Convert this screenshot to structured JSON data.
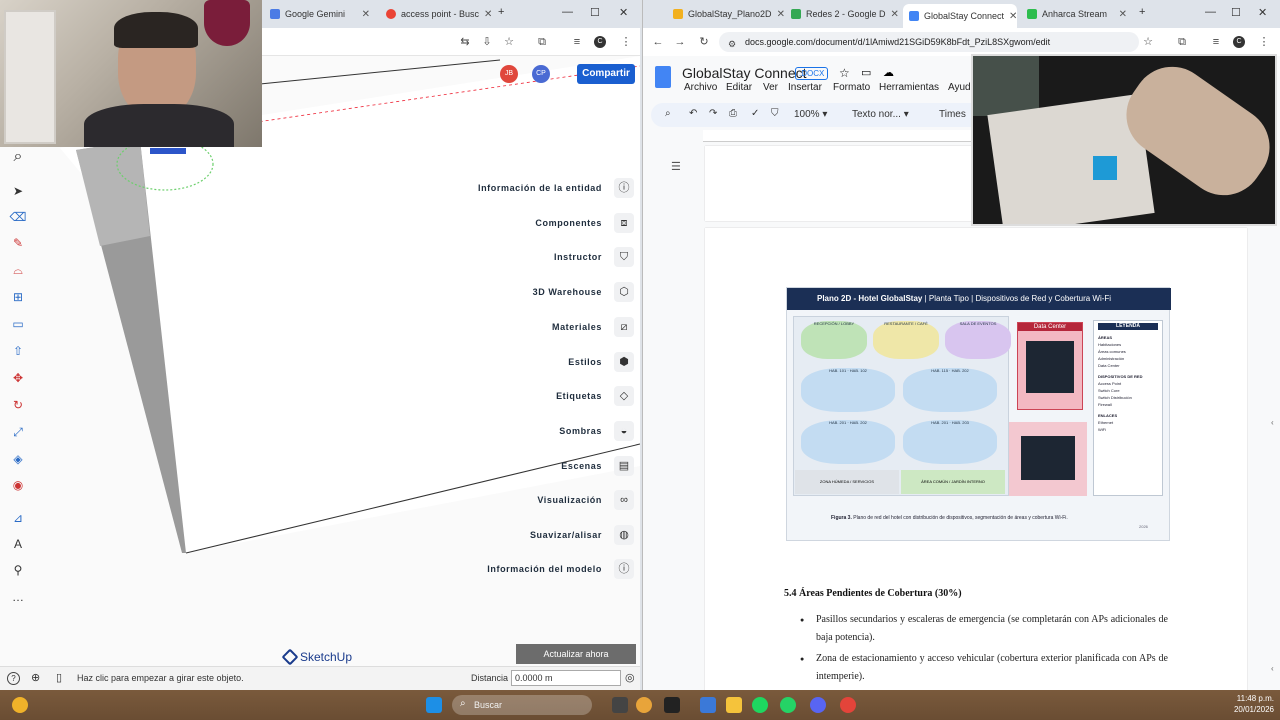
{
  "left_browser": {
    "tabs": [
      {
        "label": "Google Gemini",
        "active": false
      },
      {
        "label": "access point - Busc",
        "active": false
      }
    ],
    "share_button": "Compartir",
    "avatars": [
      "JB",
      "CP"
    ]
  },
  "sketchup": {
    "panel_items": [
      {
        "label": "Información de la entidad",
        "icon": "info-box-icon"
      },
      {
        "label": "Componentes",
        "icon": "components-icon"
      },
      {
        "label": "Instructor",
        "icon": "instructor-icon"
      },
      {
        "label": "3D Warehouse",
        "icon": "warehouse-icon"
      },
      {
        "label": "Materiales",
        "icon": "materials-icon"
      },
      {
        "label": "Estilos",
        "icon": "styles-icon"
      },
      {
        "label": "Etiquetas",
        "icon": "tags-icon"
      },
      {
        "label": "Sombras",
        "icon": "shadows-icon"
      },
      {
        "label": "Escenas",
        "icon": "scenes-icon"
      },
      {
        "label": "Visualización",
        "icon": "visualization-icon"
      },
      {
        "label": "Suavizar/alisar",
        "icon": "smooth-icon"
      },
      {
        "label": "Información del modelo",
        "icon": "model-info-icon"
      }
    ],
    "update_button": "Actualizar ahora",
    "logo_text": "SketchUp",
    "status_hint": "Haz clic para empezar a girar este objeto.",
    "distance_label": "Distancia",
    "distance_value": "0.0000 m"
  },
  "right_browser": {
    "tabs": [
      {
        "label": "GlobalStay_Plano2D",
        "active": false
      },
      {
        "label": "Redes 2 - Google D",
        "active": false
      },
      {
        "label": "GlobalStay Connect",
        "active": true
      },
      {
        "label": "Anharca Stream",
        "active": false
      }
    ],
    "url": "docs.google.com/document/d/1lAmiwd21SGiD59K8bFdt_PziL8SXgwom/edit"
  },
  "docs": {
    "title": "GlobalStay Connect",
    "badge": ".DOCX",
    "menu": [
      "Archivo",
      "Editar",
      "Ver",
      "Insertar",
      "Formato",
      "Herramientas",
      "Ayud"
    ],
    "zoom": "100%",
    "style": "Texto nor...",
    "font": "Times",
    "figure": {
      "title": "Plano 2D - Hotel GlobalStay",
      "subtitle1": "Planta Tipo",
      "subtitle2": "Dispositivos de Red y Cobertura Wi-Fi",
      "zones": [
        "RECEPCIÓN / LOBBY",
        "RESTAURANTE / CAFÉ",
        "SALA DE EVENTOS",
        "HAB. 101",
        "HAB. 102",
        "HAB. 115",
        "HAB. 202",
        "HAB. 201",
        "HAB. 202",
        "HAB. 201",
        "HAB. 203",
        "ZONA HÚMEDA / SERVICIOS",
        "ÁREA COMÚN / JARDÍN INTERNO"
      ],
      "data_center": "Data Center",
      "firewall": "Firewall",
      "legend_title": "LEYENDA",
      "legend_areas_title": "ÁREAS",
      "legend_areas": [
        "Habitaciones",
        "Áreas comunes",
        "Administración",
        "Data Center"
      ],
      "legend_devices_title": "DISPOSITIVOS DE RED",
      "legend_devices": [
        "Access Point",
        "Switch Core",
        "Switch Distribución",
        "Firewall"
      ],
      "legend_links_title": "ENLACES",
      "legend_links": [
        "Ethernet",
        "WiFi"
      ],
      "caption_bold": "Figura 3.",
      "caption": "Plano de red del hotel con distribución de dispositivos, segmentación de áreas y cobertura Wi-Fi.",
      "year": "2026"
    },
    "section_heading": "5.4 Áreas Pendientes de Cobertura (30%)",
    "bullets": [
      "Pasillos secundarios y escaleras de emergencia (se completarán con APs adicionales de baja potencia).",
      "Zona de estacionamiento y acceso vehicular (cobertura exterior planificada con APs de intemperie)."
    ]
  },
  "taskbar": {
    "search_placeholder": "Buscar",
    "time": "11:48 p.m.",
    "date": "20/01/2026"
  }
}
